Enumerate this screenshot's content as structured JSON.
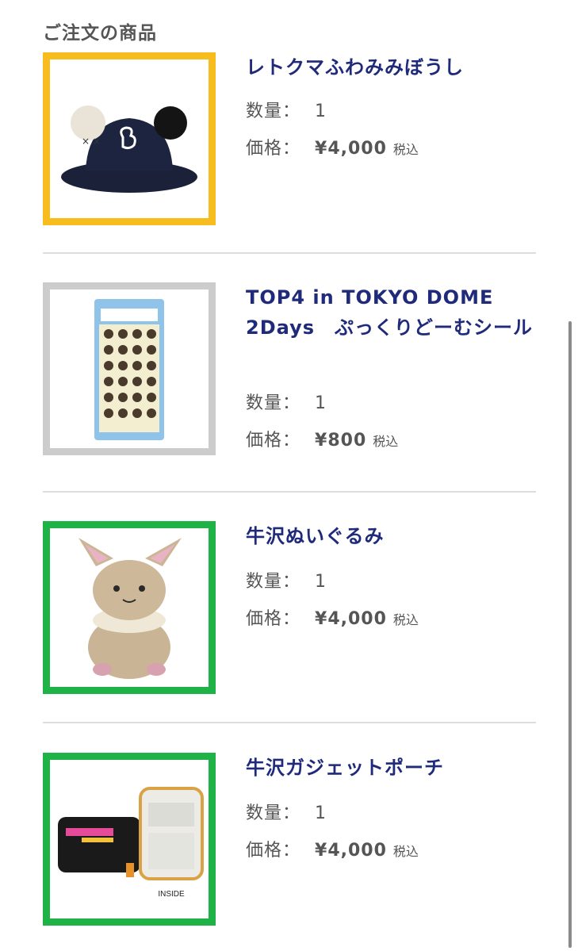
{
  "section_title": "ご注文の商品",
  "labels": {
    "quantity": "数量：",
    "price": "価格：",
    "tax": "税込"
  },
  "items": [
    {
      "name": "レトクマふわみみぼうし",
      "quantity": "1",
      "price": "¥4,000",
      "border_color": "#f7bd1e",
      "icon": "bucket-hat-icon"
    },
    {
      "name": "TOP4 in TOKYO DOME 2Days　ぷっくりどーむシール",
      "quantity": "1",
      "price": "¥800",
      "border_color": "#cccccc",
      "icon": "sticker-sheet-icon"
    },
    {
      "name": "牛沢ぬいぐるみ",
      "quantity": "1",
      "price": "¥4,000",
      "border_color": "#1fb347",
      "icon": "plush-icon"
    },
    {
      "name": "牛沢ガジェットポーチ",
      "quantity": "1",
      "price": "¥4,000",
      "border_color": "#1fb347",
      "icon": "pouch-icon",
      "image_caption": "INSIDE"
    }
  ]
}
